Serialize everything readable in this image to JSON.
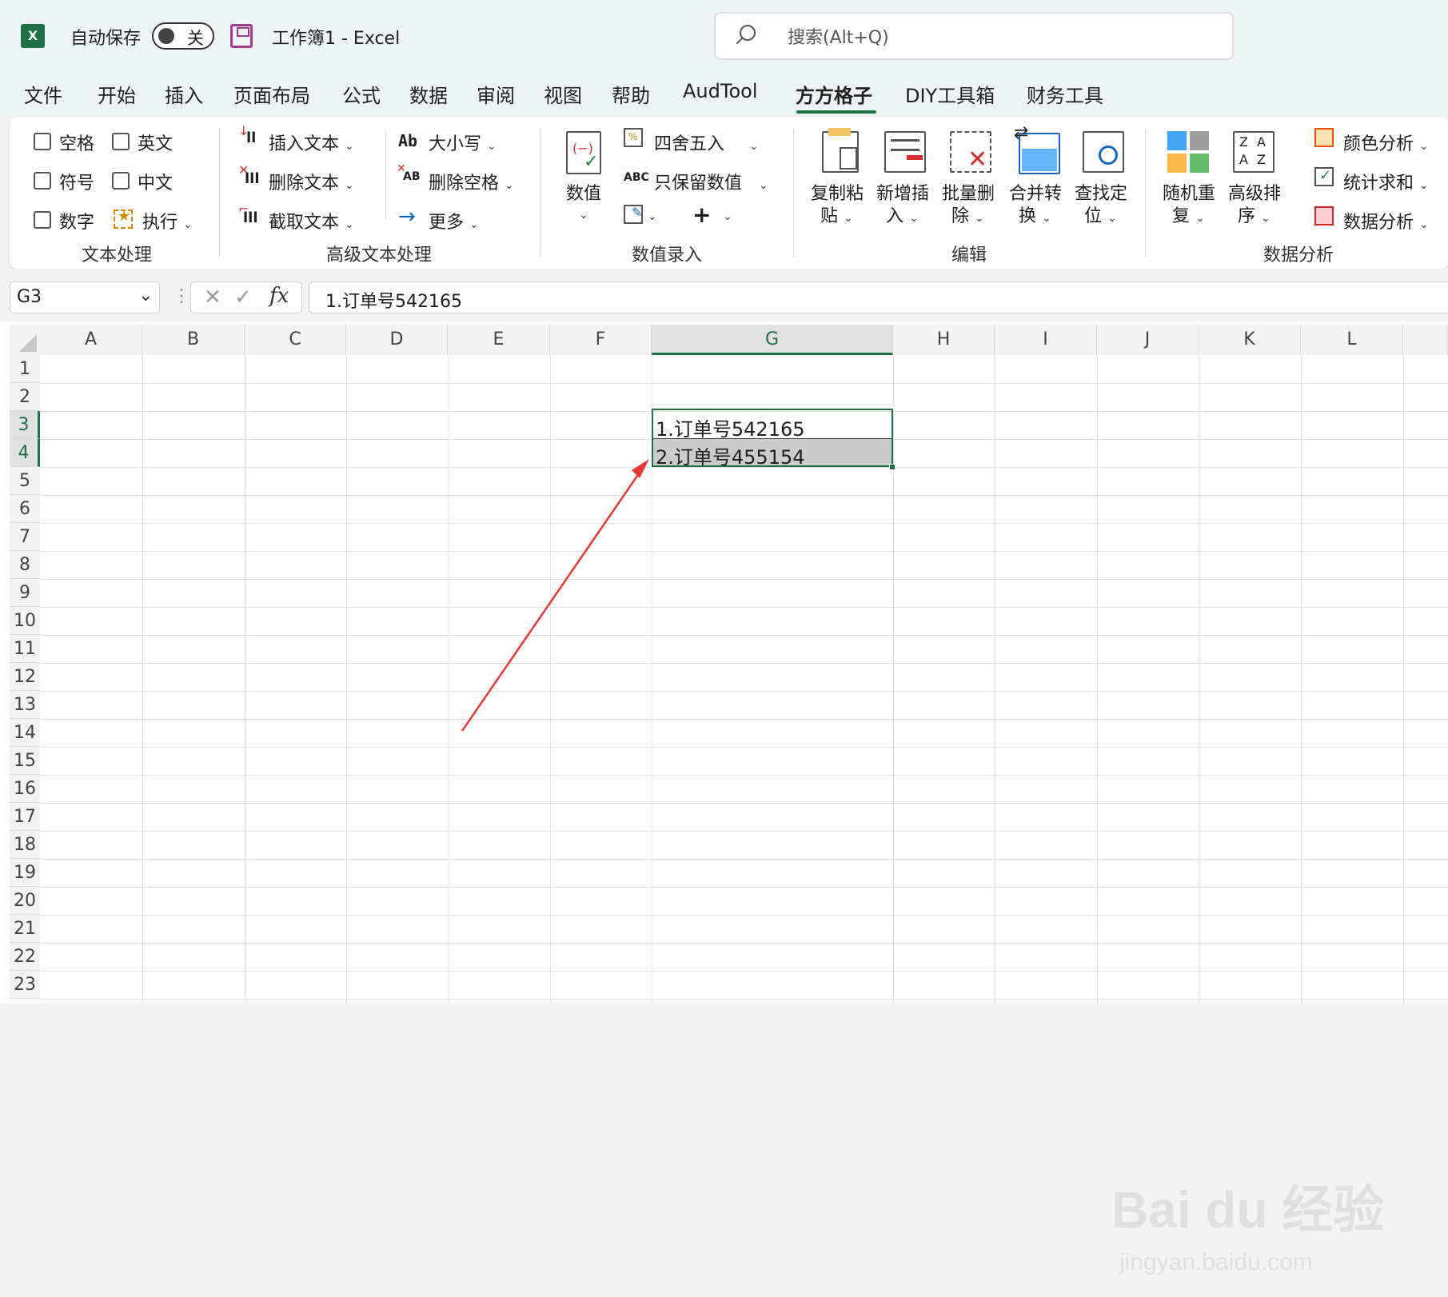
{
  "app": {
    "logo_letter": "X",
    "autosave_label": "自动保存",
    "autosave_state": "关",
    "doc_title": "工作簿1  -  Excel",
    "search_placeholder": "搜索(Alt+Q)"
  },
  "menu": {
    "items": [
      "文件",
      "开始",
      "插入",
      "页面布局",
      "公式",
      "数据",
      "审阅",
      "视图",
      "帮助",
      "AudTool",
      "方方格子",
      "DIY工具箱",
      "财务工具"
    ],
    "active": "方方格子"
  },
  "ribbon": {
    "text_processing": {
      "label": "文本处理",
      "checks": [
        "空格",
        "英文",
        "符号",
        "中文",
        "数字"
      ],
      "execute": "执行"
    },
    "advanced_text": {
      "label": "高级文本处理",
      "insert_text": "插入文本",
      "delete_text": "删除文本",
      "extract_text": "截取文本",
      "case": "大小写",
      "case_icon_text": "Ab",
      "delete_spaces": "删除空格",
      "delete_spaces_icon_text": "AB",
      "more": "更多"
    },
    "numeric_entry": {
      "label": "数值录入",
      "value_btn": "数值",
      "round": "四舍五入",
      "keep_values": "只保留数值",
      "keep_values_icon_text": "ABC"
    },
    "edit": {
      "label": "编辑",
      "copy_paste": [
        "复制粘",
        "贴"
      ],
      "insert_new": [
        "新增插",
        "入"
      ],
      "batch_delete": [
        "批量删",
        "除"
      ],
      "merge_convert": [
        "合并转",
        "换"
      ],
      "find_locate": [
        "查找定",
        "位"
      ]
    },
    "data_analysis": {
      "label": "数据分析",
      "random_repeat": [
        "随机重",
        "复"
      ],
      "advanced_sort": [
        "高级排",
        "序"
      ],
      "sort_icon_letters": [
        "Z",
        "A",
        "A",
        "Z"
      ],
      "color_analysis": "颜色分析",
      "stat_sum": "统计求和",
      "data_analysis_btn": "数据分析"
    }
  },
  "formula_bar": {
    "name_box": "G3",
    "fx": "fx",
    "content": "1.订单号542165"
  },
  "grid": {
    "columns": [
      "A",
      "B",
      "C",
      "D",
      "E",
      "F",
      "G",
      "H",
      "I",
      "J",
      "K",
      "L"
    ],
    "rows": [
      "1",
      "2",
      "3",
      "4",
      "5",
      "6",
      "7",
      "8",
      "9",
      "10",
      "11",
      "12",
      "13",
      "14",
      "15",
      "16",
      "17",
      "18",
      "19",
      "20",
      "21",
      "22",
      "23"
    ],
    "selected_column": "G",
    "selected_rows": [
      "3",
      "4"
    ],
    "cells": {
      "G3": "1.订单号542165",
      "G4": "2.订单号455154"
    }
  },
  "watermark": {
    "brand": "Bai du 经验",
    "url": "jingyan.baidu.com"
  },
  "colors": {
    "excel_green": "#1e7145",
    "arrow_red": "#e53935",
    "selection_fill": "#cccccc"
  }
}
